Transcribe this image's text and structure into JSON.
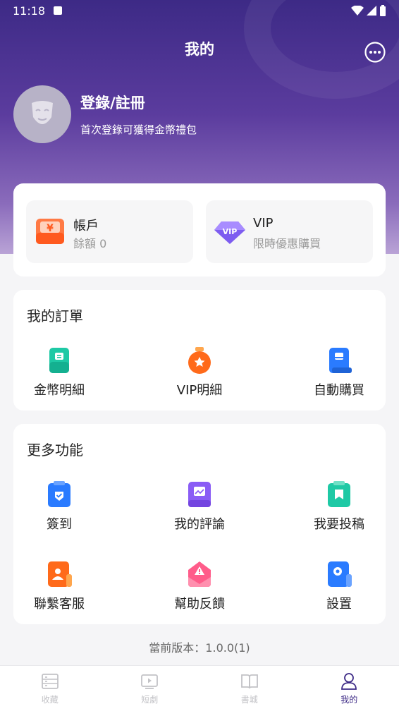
{
  "status_bar": {
    "time": "11:18"
  },
  "header": {
    "title": "我的"
  },
  "profile": {
    "login_label": "登錄/註冊",
    "subtitle": "首次登錄可獲得金幣禮包"
  },
  "wallet": {
    "account": {
      "title": "帳戶",
      "balance": "餘額 0"
    },
    "vip": {
      "badge": "VIP",
      "title": "VIP",
      "subtitle": "限時優惠購買"
    }
  },
  "orders": {
    "title": "我的訂單",
    "items": [
      {
        "label": "金幣明細",
        "icon": "coin-detail-icon",
        "color": "#1ec9a5"
      },
      {
        "label": "VIP明細",
        "icon": "vip-bag-icon",
        "color": "#ff6a1a"
      },
      {
        "label": "自動購買",
        "icon": "auto-buy-icon",
        "color": "#2a7bff"
      }
    ]
  },
  "more": {
    "title": "更多功能",
    "items": [
      {
        "label": "簽到",
        "icon": "checkin-icon",
        "color": "#2a7bff"
      },
      {
        "label": "我的評論",
        "icon": "comment-icon",
        "color": "#8a5cf5"
      },
      {
        "label": "我要投稿",
        "icon": "submit-icon",
        "color": "#1ec9a5"
      },
      {
        "label": "聯繫客服",
        "icon": "customer-service-icon",
        "color": "#ff6a1a"
      },
      {
        "label": "幫助反饋",
        "icon": "feedback-icon",
        "color": "#ff5c8a"
      },
      {
        "label": "設置",
        "icon": "settings-icon",
        "color": "#2a7bff"
      }
    ]
  },
  "version": "當前版本：1.0.0(1)",
  "tabs": [
    {
      "label": "收藏",
      "active": false
    },
    {
      "label": "短劇",
      "active": false
    },
    {
      "label": "書城",
      "active": false
    },
    {
      "label": "我的",
      "active": true
    }
  ],
  "colors": {
    "primary": "#3d2a86",
    "inactive": "#c2c2c6"
  }
}
